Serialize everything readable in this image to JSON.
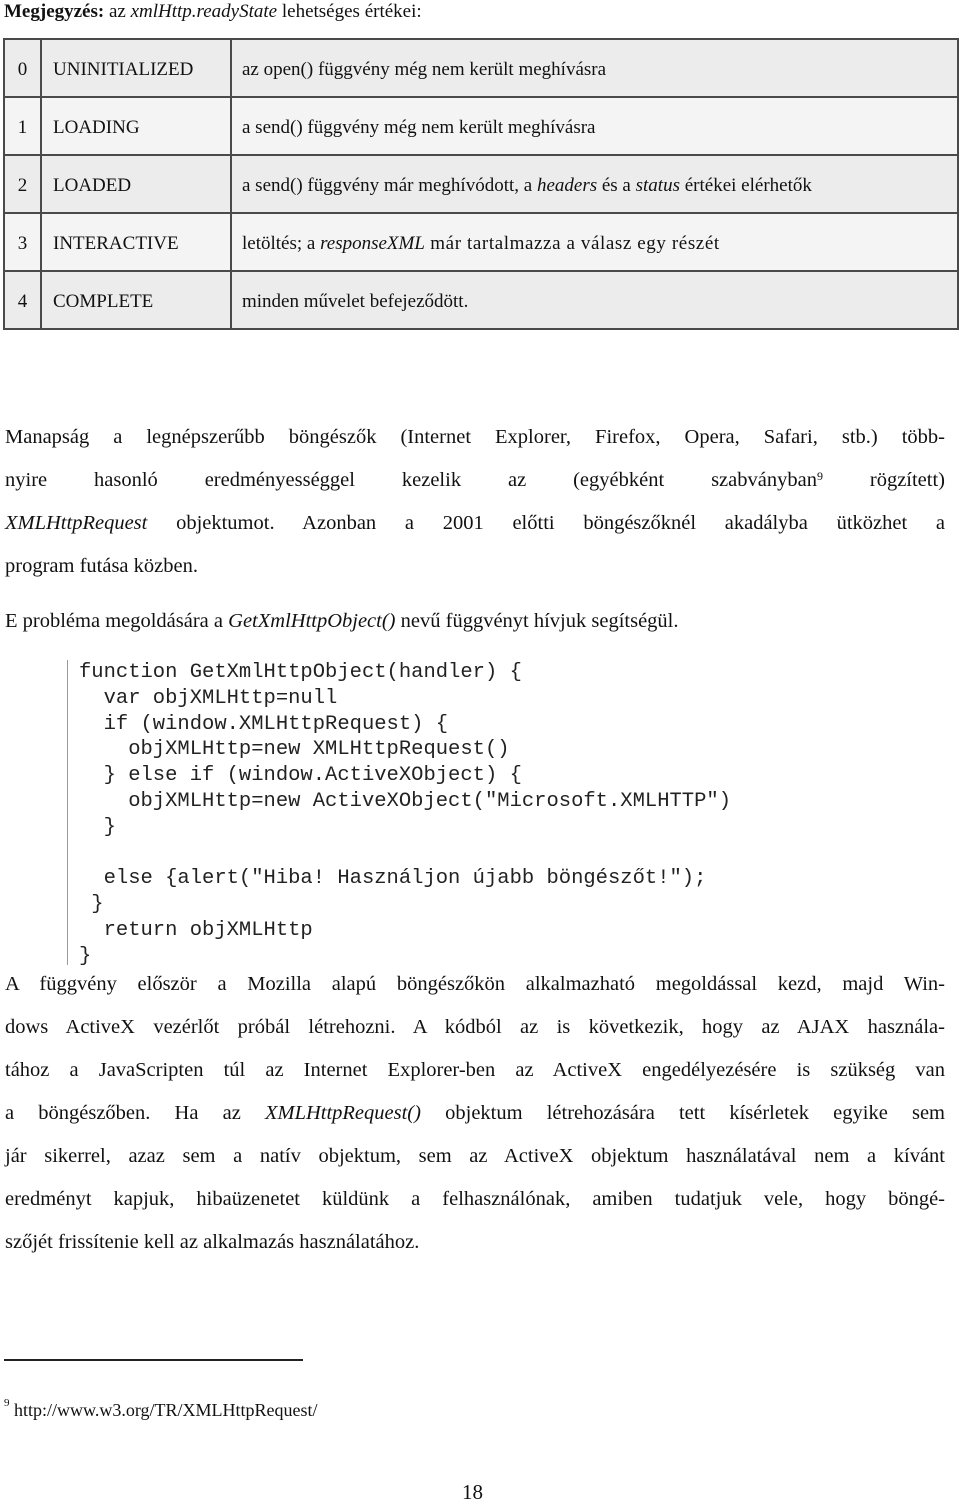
{
  "note": {
    "label": "Megjegyzés:",
    "prefix": " az ",
    "property": "xmlHttp.readyState",
    "suffix": " lehetséges értékei:"
  },
  "ready_states": {
    "rows": [
      {
        "code": "0",
        "name": "UNINITIALIZED",
        "desc": "az open() függvény még nem került meghívásra"
      },
      {
        "code": "1",
        "name": "LOADING",
        "desc": "a send() függvény még nem került meghívásra"
      },
      {
        "code": "2",
        "name": "LOADED",
        "desc_parts": [
          "a send() függvény már meghívódott, a ",
          "headers",
          " és a ",
          "status",
          " értékei elérhetők"
        ]
      },
      {
        "code": "3",
        "name": "INTERACTIVE",
        "desc_parts": [
          "letöltés; a ",
          "responseXML",
          " már tartalmazza a válasz egy részét"
        ]
      },
      {
        "code": "4",
        "name": "COMPLETE",
        "desc": "minden művelet befejeződött."
      }
    ]
  },
  "paragraph1": {
    "line1": "Manapság a legnépszerűbb böngészők (Internet Explorer, Firefox, Opera, Safari, stb.) több-",
    "line2_a": "nyire hasonló eredményességgel kezelik az (egyébként szabványban",
    "footnote_ref": "9",
    "line2_b": " rögzített)",
    "line3_italic": "XMLHttpRequest",
    "line3_rest": " objektumot. Azonban a 2001 előtti böngészőknél akadályba ütközhet a",
    "line4": "program futása közben."
  },
  "paragraph2": {
    "before": "E probléma megoldására a ",
    "italic": "GetXmlHttpObject()",
    "after": " nevű függvényt hívjuk segítségül."
  },
  "code": {
    "lines": [
      "function GetXmlHttpObject(handler) {",
      "  var objXMLHttp=null",
      "  if (window.XMLHttpRequest) {",
      "    objXMLHttp=new XMLHttpRequest()",
      "  } else if (window.ActiveXObject) {",
      "    objXMLHttp=new ActiveXObject(\"Microsoft.XMLHTTP\")",
      "  }",
      "",
      "  else {alert(\"Hiba! Használjon újabb böngészőt!\");",
      " }",
      "  return objXMLHttp",
      "}"
    ]
  },
  "paragraph3": {
    "line1": "A függvény először a Mozilla alapú böngészőkön alkalmazható megoldással kezd, majd Win-",
    "line2": "dows ActiveX vezérlőt próbál létrehozni. A kódból az is következik, hogy az AJAX használa-",
    "line3": "tához a JavaScripten túl az Internet Explorer-ben az ActiveX engedélyezésére is szükség van",
    "line4_a": "a böngészőben. Ha az ",
    "line4_italic": "XMLHttpRequest()",
    "line4_b": " objektum létrehozására tett kísérletek egyike sem",
    "line5": "jár sikerrel, azaz sem a natív objektum, sem az ActiveX objektum használatával nem a kívánt",
    "line6": "eredményt kapjuk, hibaüzenetet küldünk a felhasználónak, amiben tudatjuk vele, hogy böngé-",
    "line7": "szőjét frissítenie kell az alkalmazás használatához."
  },
  "footnote": {
    "number": "9",
    "text": " http://www.w3.org/TR/XMLHttpRequest/"
  },
  "page_number": "18"
}
